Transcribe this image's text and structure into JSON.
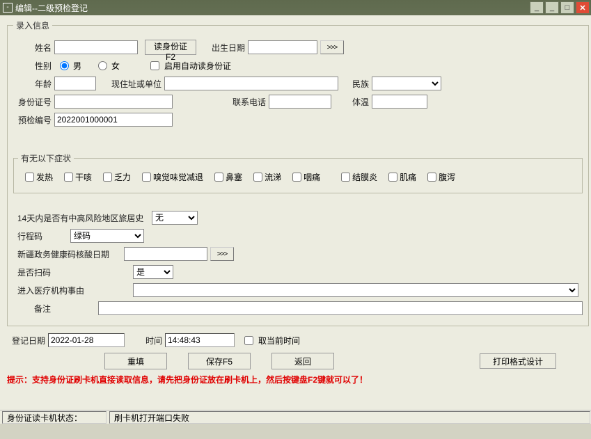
{
  "window": {
    "title": "编辑--二级预检登记"
  },
  "input_group": "录入信息",
  "labels": {
    "name": "姓名",
    "read_id": "读身份证F2",
    "birth": "出生日期",
    "gender": "性别",
    "male": "男",
    "female": "女",
    "auto_read": "启用自动读身份证",
    "age": "年龄",
    "address": "现住址或单位",
    "ethnic": "民族",
    "idno": "身份证号",
    "phone": "联系电话",
    "temp": "体温",
    "pre_no": "预检编号"
  },
  "values": {
    "name": "",
    "birth": "",
    "age": "",
    "address": "",
    "ethnic": "",
    "idno": "",
    "phone": "",
    "temp": "",
    "pre_no": "2022001000001"
  },
  "symptom_group": "有无以下症状",
  "symptoms": [
    "发热",
    "干咳",
    "乏力",
    "嗅觉味觉减退",
    "鼻塞",
    "流涕",
    "咽痛",
    "结膜炎",
    "肌痛",
    "腹泻"
  ],
  "q": {
    "travel14": "14天内是否有中高风险地区旅居史",
    "travel14_val": "无",
    "trip_code": "行程码",
    "trip_code_val": "绿码",
    "xj_date": "新疆政务健康码核酸日期",
    "xj_date_val": "",
    "scan": "是否扫码",
    "scan_val": "是",
    "reason": "进入医疗机构事由",
    "reason_val": "",
    "remark": "备注",
    "remark_val": ""
  },
  "reg": {
    "date_lab": "登记日期",
    "date_val": "2022-01-28",
    "time_lab": "时间",
    "time_val": "14:48:43",
    "take_now": "取当前时间"
  },
  "buttons": {
    "refill": "重填",
    "save": "保存F5",
    "back": "返回",
    "print": "打印格式设计",
    "more": ">>>"
  },
  "hint": "提示：支持身份证刷卡机直接读取信息，请先把身份证放在刷卡机上，然后按键盘F2键就可以了！",
  "status": {
    "label": "身份证读卡机状态：",
    "value": "刷卡机打开端口失败"
  }
}
